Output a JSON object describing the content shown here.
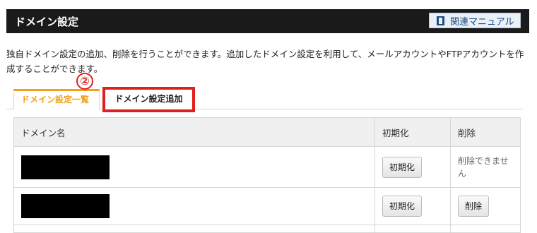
{
  "header": {
    "title": "ドメイン設定",
    "manual_label": "関連マニュアル"
  },
  "description": "独自ドメイン設定の追加、削除を行うことができます。追加したドメイン設定を利用して、メールアカウントやFTPアカウントを作成することができます。",
  "tabs": {
    "list_label": "ドメイン設定一覧",
    "add_label": "ドメイン設定追加"
  },
  "step_marker": "②",
  "table": {
    "headers": {
      "name": "ドメイン名",
      "init": "初期化",
      "delete": "削除"
    },
    "rows": [
      {
        "init_button": "初期化",
        "delete_text": "削除できません"
      },
      {
        "init_button": "初期化",
        "delete_button": "削除"
      }
    ]
  }
}
